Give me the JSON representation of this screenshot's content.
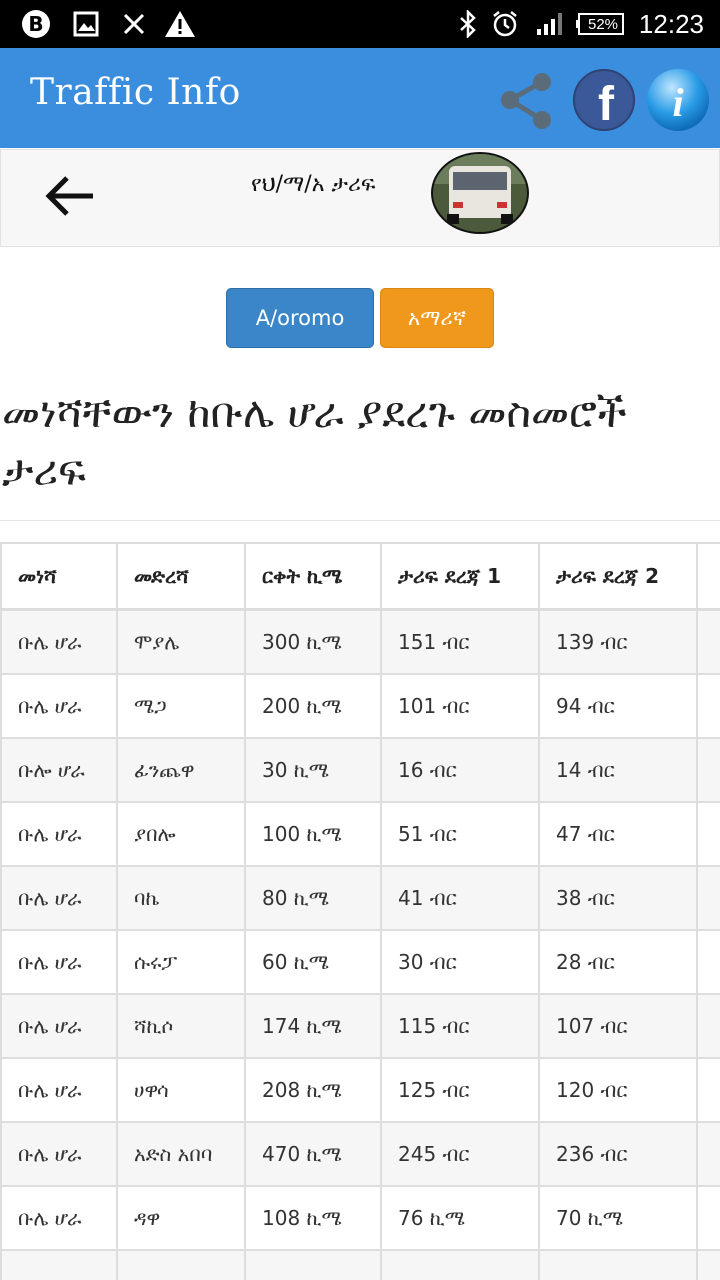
{
  "status_bar": {
    "time": "12:23",
    "battery": "52%",
    "icons": [
      "b-app-icon",
      "image-icon",
      "close-icon",
      "warning-icon",
      "bluetooth-icon",
      "alarm-icon",
      "signal-icon",
      "battery-icon"
    ]
  },
  "app_bar": {
    "title": "Traffic Info",
    "actions": [
      "share-icon",
      "facebook-icon",
      "info-icon"
    ],
    "accent": "#3b8ede"
  },
  "sub_header": {
    "title": "የህ/ማ/አ ታሪፍ"
  },
  "language_buttons": [
    {
      "label": "A/oromo",
      "color": "#3a86c8"
    },
    {
      "label": "አማሪኛ",
      "color": "#f0981b"
    }
  ],
  "page_heading": "መነሻቸውን ከቡሌ ሆራ ያደረጉ መስመሮች ታሪፍ",
  "table": {
    "headers": [
      "መነሻ",
      "መድረሻ",
      "ርቀት ኪሜ",
      "ታሪፍ ደረጃ 1",
      "ታሪፍ ደረጃ 2",
      ""
    ],
    "rows": [
      [
        "ቡሌ ሆራ",
        "ሞያሌ",
        "300 ኪሜ",
        "151 ብር",
        "139 ብር",
        ""
      ],
      [
        "ቡሌ ሆራ",
        "ሜጋ",
        "200 ኪሜ",
        "101 ብር",
        "94 ብር",
        ""
      ],
      [
        "ቡሎ ሆራ",
        "ፊንጨዋ",
        "30 ኪሜ",
        "16 ብር",
        "14 ብር",
        ""
      ],
      [
        "ቡሌ ሆራ",
        "ያበሎ",
        "100 ኪሜ",
        "51 ብር",
        "47 ብር",
        ""
      ],
      [
        "ቡሌ ሆራ",
        "ባኬ",
        "80 ኪሜ",
        "41 ብር",
        "38 ብር",
        ""
      ],
      [
        "ቡሌ ሆራ",
        "ሱሩፓ",
        "60 ኪሜ",
        "30 ብር",
        "28 ብር",
        ""
      ],
      [
        "ቡሌ ሆራ",
        "ሻኪሶ",
        "174 ኪሜ",
        "115 ብር",
        "107 ብር",
        ""
      ],
      [
        "ቡሌ ሆራ",
        "ሀዋሳ",
        "208 ኪሜ",
        "125 ብር",
        "120 ብር",
        ""
      ],
      [
        "ቡሌ ሆራ",
        "አድስ አበባ",
        "470 ኪሜ",
        "245 ብር",
        "236 ብር",
        ""
      ],
      [
        "ቡሌ ሆራ",
        "ዳዋ",
        "108 ኪሜ",
        "76 ኪሜ",
        "70 ኪሜ",
        ""
      ],
      [
        "",
        "",
        "",
        "",
        "",
        ""
      ]
    ]
  }
}
